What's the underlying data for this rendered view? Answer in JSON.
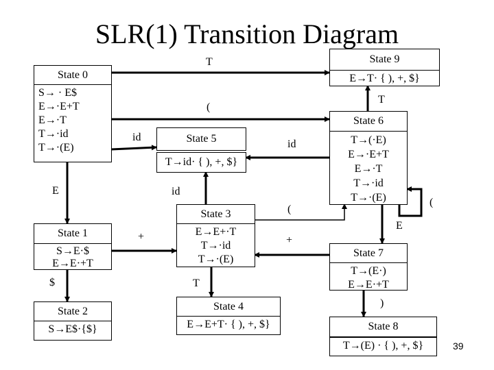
{
  "title": "SLR(1) Transition Diagram",
  "page_number": "39",
  "states": {
    "s0": {
      "name": "State 0",
      "items": [
        "S→ · E$",
        "E→·E+T",
        "E→·T",
        "T→·id",
        "T→·(E)"
      ]
    },
    "s1": {
      "name": "State 1",
      "items": [
        "S→E·$",
        "E→E·+T"
      ]
    },
    "s2": {
      "name": "State 2",
      "items": [
        "S→E$·{$}"
      ]
    },
    "s3": {
      "name": "State 3",
      "items": [
        "E→E+·T",
        "T→·id",
        "T→·(E)"
      ]
    },
    "s4": {
      "name": "State 4",
      "items": [
        "E→E+T· { ), +, $}"
      ]
    },
    "s5": {
      "name": "State 5",
      "items": [
        "T→id· { ), +, $}"
      ]
    },
    "s6": {
      "name": "State 6",
      "items": [
        "T→(·E)",
        "E→·E+T",
        "E→·T",
        "T→·id",
        "T→·(E)"
      ]
    },
    "s7": {
      "name": "State 7",
      "items": [
        "T→(E·)",
        "E→E·+T"
      ]
    },
    "s8": {
      "name": "State 8",
      "items": [
        "T→(E) · { ), +, $}"
      ]
    },
    "s9": {
      "name": "State 9",
      "items": [
        "E→T· { ), +, $}"
      ]
    }
  },
  "transitions": [
    {
      "from": "State 0",
      "to": "State 9",
      "symbol": "T"
    },
    {
      "from": "State 0",
      "to": "State 6",
      "symbol": "("
    },
    {
      "from": "State 0",
      "to": "State 5",
      "symbol": "id"
    },
    {
      "from": "State 0",
      "to": "State 1",
      "symbol": "E"
    },
    {
      "from": "State 1",
      "to": "State 2",
      "symbol": "$"
    },
    {
      "from": "State 1",
      "to": "State 3",
      "symbol": "+"
    },
    {
      "from": "State 3",
      "to": "State 5",
      "symbol": "id"
    },
    {
      "from": "State 3",
      "to": "State 4",
      "symbol": "T"
    },
    {
      "from": "State 3",
      "to": "State 6",
      "symbol": "("
    },
    {
      "from": "State 6",
      "to": "State 9",
      "symbol": "T"
    },
    {
      "from": "State 6",
      "to": "State 5",
      "symbol": "id"
    },
    {
      "from": "State 6",
      "to": "State 6",
      "symbol": "("
    },
    {
      "from": "State 6",
      "to": "State 7",
      "symbol": "E"
    },
    {
      "from": "State 7",
      "to": "State 3",
      "symbol": "+"
    },
    {
      "from": "State 7",
      "to": "State 8",
      "symbol": ")"
    }
  ]
}
